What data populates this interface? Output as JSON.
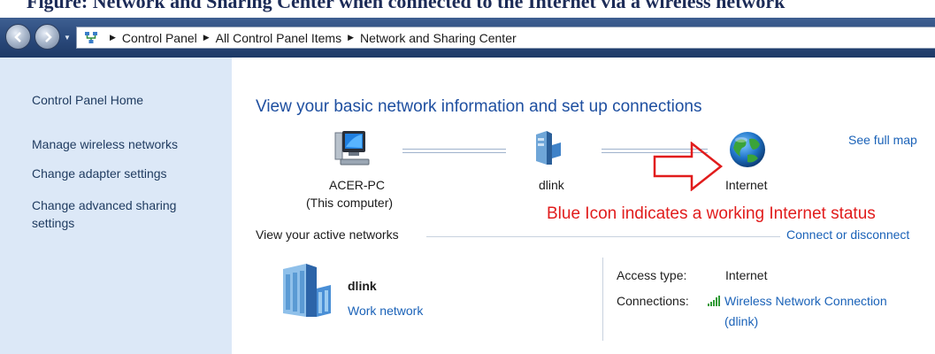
{
  "caption": {
    "text": "Figure: Network and Sharing Center when connected to the Internet via a wireless network"
  },
  "navbar": {
    "breadcrumb": [
      "Control Panel",
      "All Control Panel Items",
      "Network and Sharing Center"
    ]
  },
  "sidebar": {
    "home": "Control Panel Home",
    "links": [
      "Manage wireless networks",
      "Change adapter settings",
      "Change advanced sharing",
      "settings"
    ]
  },
  "main": {
    "title": "View your basic network information and set up connections",
    "see_full_map": "See full map",
    "map": {
      "computer_name": "ACER-PC",
      "computer_sub": "(This computer)",
      "router_name": "dlink",
      "internet_name": "Internet"
    },
    "annotation": "Blue Icon indicates a working Internet status",
    "active_networks_label": "View your active networks",
    "connect_link": "Connect or disconnect",
    "network": {
      "name": "dlink",
      "type_link": "Work network",
      "access_label": "Access type:",
      "access_value": "Internet",
      "connections_label": "Connections:",
      "connection_link_line1": "Wireless Network Connection",
      "connection_link_line2": "(dlink)"
    }
  },
  "icons": {
    "back": "back-arrow-icon",
    "forward": "forward-arrow-icon",
    "address": "network-sharing-icon",
    "computer": "computer-icon",
    "router": "router-icon",
    "internet": "globe-icon",
    "network": "network-building-icon",
    "signal": "wifi-signal-icon",
    "annotation_arrow": "red-arrow-icon"
  },
  "colors": {
    "sidebar_bg": "#dce8f7",
    "link": "#1a62b8",
    "title": "#1e4fa0",
    "annotation": "#e11c1c",
    "navbar": "#2b4a7c"
  }
}
